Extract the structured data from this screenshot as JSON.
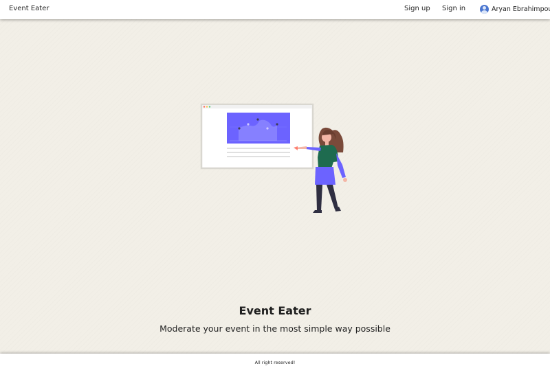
{
  "navbar": {
    "brand": "Event Eater",
    "signup_label": "Sign up",
    "signin_label": "Sign in",
    "user": {
      "name": "Aryan Ebrahimpour",
      "icon": "user-avatar-icon"
    }
  },
  "hero": {
    "title": "Event Eater",
    "subtitle": "Moderate your event in the most simple way possible",
    "illustration": "presentation-illustration"
  },
  "footer": {
    "text": "All right reserved!"
  },
  "colors": {
    "background": "#f2efe7",
    "accent": "#6c63ff",
    "avatar": "#4a76d0",
    "jacket": "#1e6b4f"
  }
}
